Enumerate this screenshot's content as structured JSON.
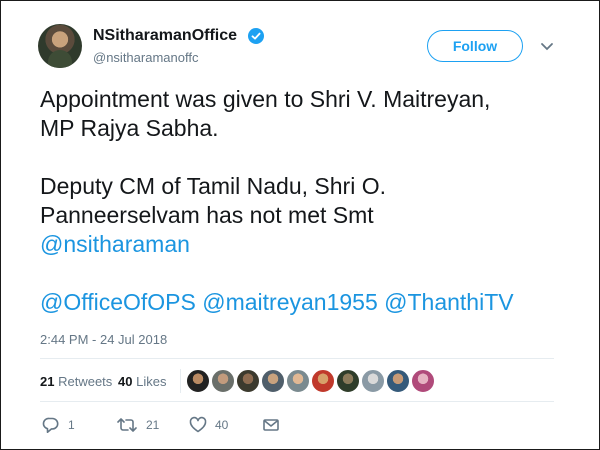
{
  "tweet": {
    "display_name": "NSitharamanOffice",
    "handle": "@nsitharamanoffc",
    "follow_label": "Follow",
    "text_line1": "Appointment was given to Shri V. Maitreyan,",
    "text_line2": "MP Rajya Sabha.",
    "text_line3": "Deputy CM of Tamil Nadu, Shri O.",
    "text_line4": "Panneerselvam has not met Smt",
    "mention1": "@nsitharaman",
    "mention2": "@OfficeOfOPS",
    "mention3": "@maitreyan1955",
    "mention4": "@ThanthiTV",
    "timestamp": "2:44 PM - 24 Jul 2018"
  },
  "stats": {
    "retweets_count": "21",
    "retweets_label": "Retweets",
    "likes_count": "40",
    "likes_label": "Likes"
  },
  "actions": {
    "reply_count": "1",
    "retweet_count": "21",
    "like_count": "40"
  },
  "colors": {
    "accent": "#1da1f2",
    "mention": "#1b95e0",
    "muted": "#657786"
  },
  "icons": [
    "verified-badge-icon",
    "chevron-down-icon",
    "reply-icon",
    "retweet-icon",
    "heart-icon",
    "envelope-icon"
  ]
}
